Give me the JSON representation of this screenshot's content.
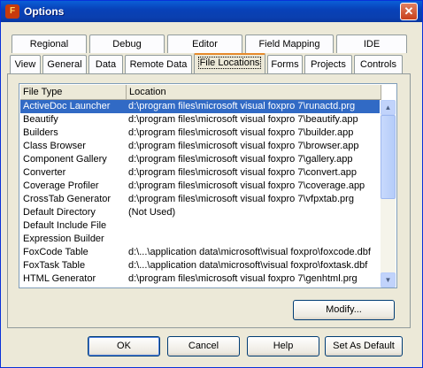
{
  "window": {
    "title": "Options",
    "close_glyph": "✕",
    "app_icon_glyph": "F"
  },
  "tabs_row1": [
    "Regional",
    "Debug",
    "Editor",
    "Field Mapping",
    "IDE"
  ],
  "tabs_row2": [
    "View",
    "General",
    "Data",
    "Remote Data",
    "File Locations",
    "Forms",
    "Projects",
    "Controls"
  ],
  "active_tab": "File Locations",
  "list": {
    "columns": [
      "File Type",
      "Location"
    ],
    "rows": [
      {
        "type": "ActiveDoc Launcher",
        "location": "d:\\program files\\microsoft visual foxpro 7\\runactd.prg",
        "selected": true
      },
      {
        "type": "Beautify",
        "location": "d:\\program files\\microsoft visual foxpro 7\\beautify.app"
      },
      {
        "type": "Builders",
        "location": "d:\\program files\\microsoft visual foxpro 7\\builder.app"
      },
      {
        "type": "Class Browser",
        "location": "d:\\program files\\microsoft visual foxpro 7\\browser.app"
      },
      {
        "type": "Component Gallery",
        "location": "d:\\program files\\microsoft visual foxpro 7\\gallery.app"
      },
      {
        "type": "Converter",
        "location": "d:\\program files\\microsoft visual foxpro 7\\convert.app"
      },
      {
        "type": "Coverage Profiler",
        "location": "d:\\program files\\microsoft visual foxpro 7\\coverage.app"
      },
      {
        "type": "CrossTab Generator",
        "location": "d:\\program files\\microsoft visual foxpro 7\\vfpxtab.prg"
      },
      {
        "type": "Default Directory",
        "location": "(Not Used)"
      },
      {
        "type": "Default Include File",
        "location": ""
      },
      {
        "type": "Expression Builder",
        "location": ""
      },
      {
        "type": "FoxCode Table",
        "location": "d:\\...\\application data\\microsoft\\visual foxpro\\foxcode.dbf"
      },
      {
        "type": "FoxTask Table",
        "location": "d:\\...\\application data\\microsoft\\visual foxpro\\foxtask.dbf"
      },
      {
        "type": "HTML Generator",
        "location": "d:\\program files\\microsoft visual foxpro 7\\genhtml.prg"
      }
    ]
  },
  "scrollbar": {
    "up_glyph": "▲",
    "down_glyph": "▼"
  },
  "buttons": {
    "modify": "Modify...",
    "ok": "OK",
    "cancel": "Cancel",
    "help": "Help",
    "set_default": "Set As Default"
  },
  "colors": {
    "selection": "#316ac5",
    "tab_highlight": "#e68b2c",
    "titlebar": "#0a46c0"
  }
}
